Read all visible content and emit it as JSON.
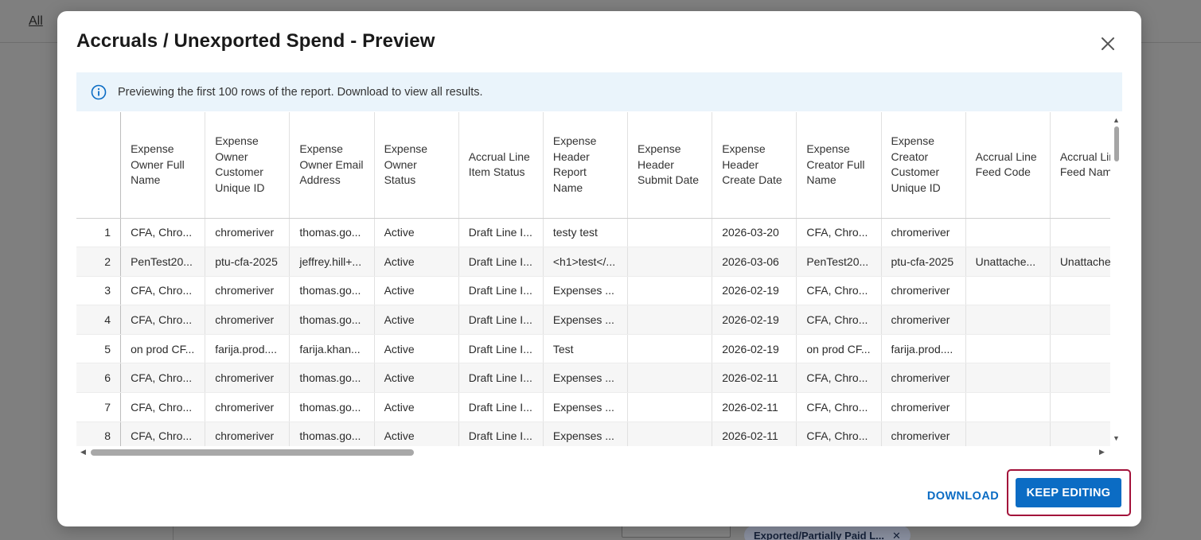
{
  "background": {
    "nav_link": "All",
    "chip_label": "Exported/Partially Paid L...",
    "chip_remove": "✕"
  },
  "modal": {
    "title": "Accruals / Unexported Spend - Preview",
    "close_icon": "close-icon",
    "info_icon": "info-circle-icon",
    "info_text": "Previewing the first 100 rows of the report. Download to view all results.",
    "download_label": "DOWNLOAD",
    "keep_editing_label": "KEEP EDITING",
    "accent_color": "#0b6cc4",
    "highlight_color": "#a3123a"
  },
  "table": {
    "columns": [
      "Expense Owner Full Name",
      "Expense Owner Customer Unique ID",
      "Expense Owner Email Address",
      "Expense Owner Status",
      "Accrual Line Item Status",
      "Expense Header Report Name",
      "Expense Header Submit Date",
      "Expense Header Create Date",
      "Expense Creator Full Name",
      "Expense Creator Customer Unique ID",
      "Accrual Line Feed Code",
      "Accrual Line Feed Name"
    ],
    "rows": [
      {
        "n": "1",
        "c": [
          "CFA, Chro...",
          "chromeriver",
          "thomas.go...",
          "Active",
          "Draft Line I...",
          "testy test",
          "",
          "2026-03-20",
          "CFA, Chro...",
          "chromeriver",
          "",
          ""
        ]
      },
      {
        "n": "2",
        "c": [
          "PenTest20...",
          "ptu-cfa-2025",
          "jeffrey.hill+...",
          "Active",
          "Draft Line I...",
          "<h1>test</...",
          "",
          "2026-03-06",
          "PenTest20...",
          "ptu-cfa-2025",
          "Unattache...",
          "Unattache..."
        ]
      },
      {
        "n": "3",
        "c": [
          "CFA, Chro...",
          "chromeriver",
          "thomas.go...",
          "Active",
          "Draft Line I...",
          "Expenses ...",
          "",
          "2026-02-19",
          "CFA, Chro...",
          "chromeriver",
          "",
          ""
        ]
      },
      {
        "n": "4",
        "c": [
          "CFA, Chro...",
          "chromeriver",
          "thomas.go...",
          "Active",
          "Draft Line I...",
          "Expenses ...",
          "",
          "2026-02-19",
          "CFA, Chro...",
          "chromeriver",
          "",
          ""
        ]
      },
      {
        "n": "5",
        "c": [
          "on prod CF...",
          "farija.prod....",
          "farija.khan...",
          "Active",
          "Draft Line I...",
          "Test",
          "",
          "2026-02-19",
          "on prod CF...",
          "farija.prod....",
          "",
          ""
        ]
      },
      {
        "n": "6",
        "c": [
          "CFA, Chro...",
          "chromeriver",
          "thomas.go...",
          "Active",
          "Draft Line I...",
          "Expenses ...",
          "",
          "2026-02-11",
          "CFA, Chro...",
          "chromeriver",
          "",
          ""
        ]
      },
      {
        "n": "7",
        "c": [
          "CFA, Chro...",
          "chromeriver",
          "thomas.go...",
          "Active",
          "Draft Line I...",
          "Expenses ...",
          "",
          "2026-02-11",
          "CFA, Chro...",
          "chromeriver",
          "",
          ""
        ]
      },
      {
        "n": "8",
        "c": [
          "CFA, Chro...",
          "chromeriver",
          "thomas.go...",
          "Active",
          "Draft Line I...",
          "Expenses ...",
          "",
          "2026-02-11",
          "CFA, Chro...",
          "chromeriver",
          "",
          ""
        ]
      }
    ]
  }
}
